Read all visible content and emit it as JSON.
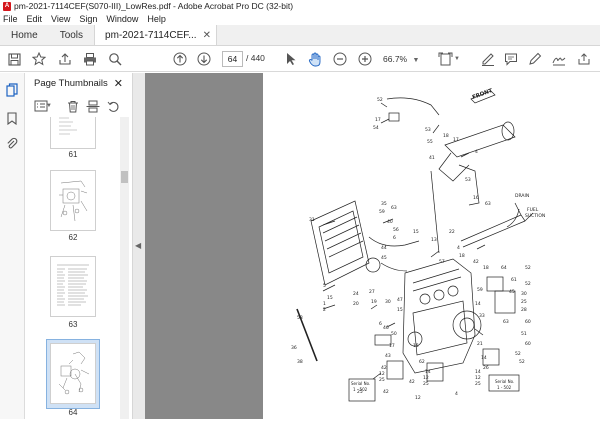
{
  "window": {
    "title": "pm-2021-7114CEF(S070-III)_LowRes.pdf - Adobe Acrobat Pro DC (32-bit)"
  },
  "menu": [
    "File",
    "Edit",
    "View",
    "Sign",
    "Window",
    "Help"
  ],
  "tabs": {
    "home": "Home",
    "tools": "Tools",
    "document": "pm-2021-7114CEF..."
  },
  "toolbar": {
    "page_number": "64",
    "page_total": "/ 440",
    "zoom": "66.7%"
  },
  "thumbnail_panel": {
    "title": "Page Thumbnails",
    "pages": [
      {
        "label": "61"
      },
      {
        "label": "62"
      },
      {
        "label": "63"
      },
      {
        "label": "64"
      }
    ],
    "selected_page": "64"
  },
  "diagram": {
    "labels": {
      "front": "FRONT",
      "drain": "DRAIN",
      "fuel_suction": "FUEL\nSUCTION",
      "serial_left": "Serial No.\n1 - 502",
      "serial_right": "Serial No.\n1 - 502"
    },
    "callouts": [
      "52",
      "17",
      "54",
      "53",
      "55",
      "41",
      "18",
      "17",
      "4",
      "53",
      "16",
      "63",
      "35",
      "59",
      "63",
      "31",
      "40",
      "56",
      "6",
      "44",
      "45",
      "15",
      "13",
      "22",
      "4",
      "57",
      "18",
      "42",
      "18",
      "64",
      "61",
      "45",
      "30",
      "25",
      "28",
      "63",
      "5",
      "15",
      "1",
      "2",
      "24",
      "20",
      "27",
      "19",
      "30",
      "47",
      "15",
      "50",
      "46",
      "17",
      "15",
      "62",
      "6",
      "36",
      "58",
      "43",
      "42",
      "12",
      "25",
      "59",
      "14",
      "33",
      "21",
      "14",
      "26",
      "52",
      "60",
      "51",
      "38",
      "14",
      "12",
      "25",
      "25",
      "14",
      "12",
      "25",
      "42",
      "42",
      "12",
      "4",
      "52",
      "52",
      "60",
      "52"
    ]
  }
}
